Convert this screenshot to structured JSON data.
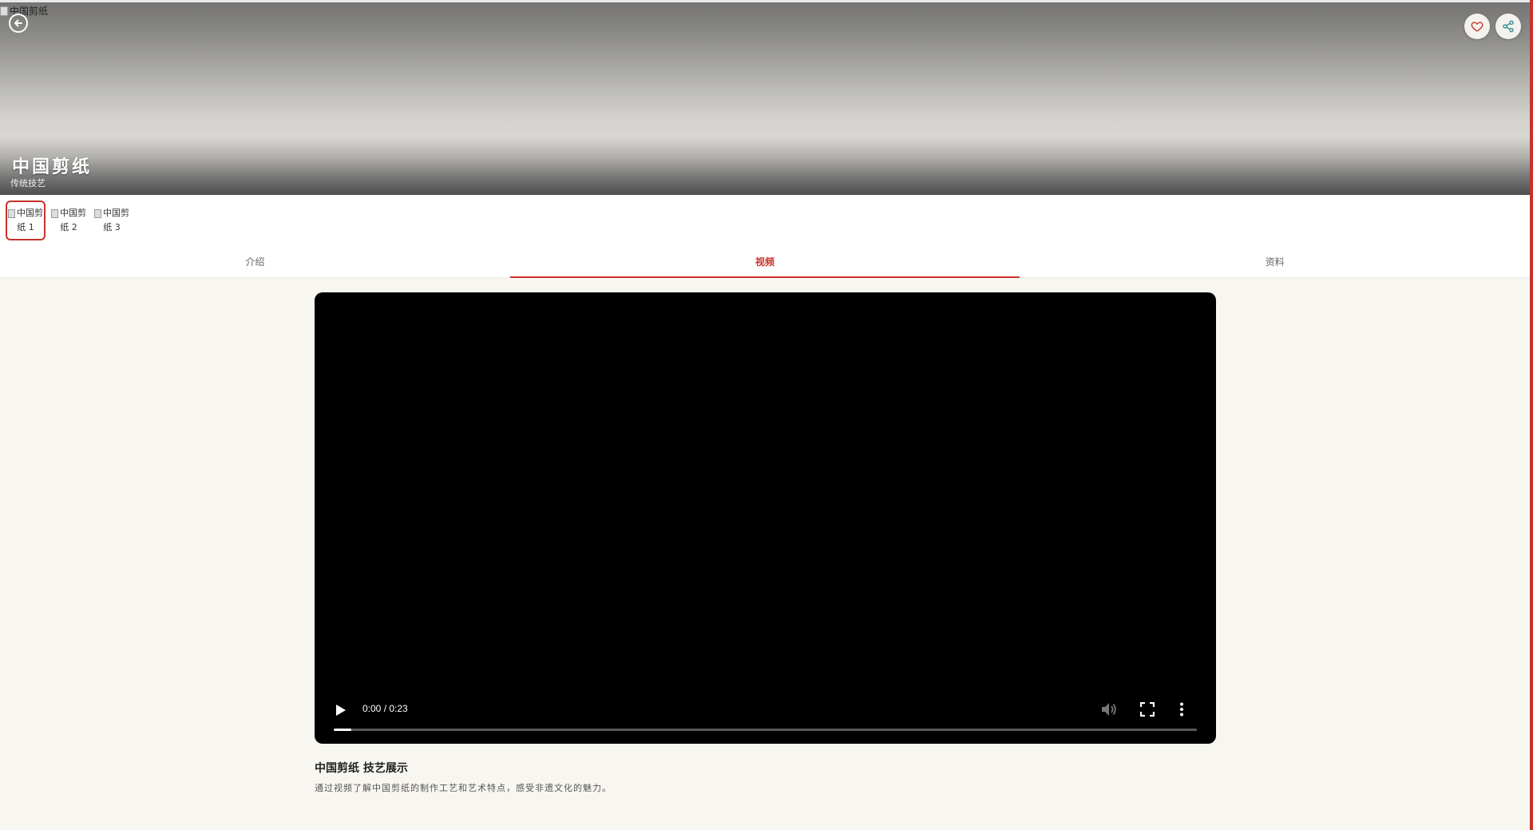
{
  "hero": {
    "image_alt": "中国剪纸",
    "title": "中国剪纸",
    "subtitle": "传统技艺",
    "back_icon": "arrow-left-circle-icon",
    "favorite_icon": "heart-icon",
    "share_icon": "share-icon"
  },
  "thumbnails": [
    {
      "alt": "中国剪纸 1",
      "active": true
    },
    {
      "alt": "中国剪纸 2",
      "active": false
    },
    {
      "alt": "中国剪纸 3",
      "active": false
    }
  ],
  "tabs": [
    {
      "label": "介绍",
      "active": false
    },
    {
      "label": "视频",
      "active": true
    },
    {
      "label": "资料",
      "active": false
    }
  ],
  "video": {
    "time": "0:00 / 0:23",
    "progress": 0.0,
    "play_icon": "play-icon",
    "volume_icon": "volume-icon",
    "fullscreen_icon": "fullscreen-icon",
    "more_icon": "more-vertical-icon",
    "title": "中国剪纸 技艺展示",
    "description": "通过视频了解中国剪纸的制作工艺和艺术特点，感受非遗文化的魅力。"
  },
  "colors": {
    "accent": "#c8322b",
    "page_background": "#f8f6f1"
  }
}
